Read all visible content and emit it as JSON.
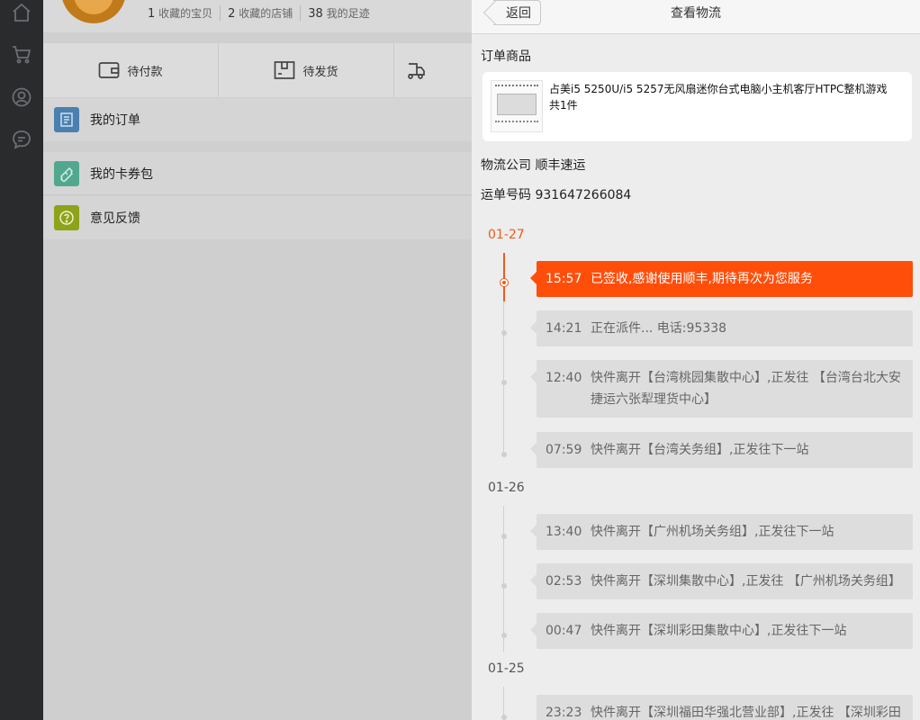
{
  "sidebar": {
    "icons": [
      "home-icon",
      "cart-icon",
      "user-icon",
      "message-icon"
    ]
  },
  "profile": {
    "stats": [
      {
        "num": "1",
        "label": "收藏的宝贝"
      },
      {
        "num": "2",
        "label": "收藏的店铺"
      },
      {
        "num": "38",
        "label": "我的足迹"
      }
    ]
  },
  "order_tabs": [
    {
      "label": "待付款",
      "icon": "wallet-icon"
    },
    {
      "label": "待发货",
      "icon": "package-icon"
    },
    {
      "label": "",
      "icon": "truck-icon"
    }
  ],
  "menu": {
    "my_orders": "我的订单",
    "coupons": "我的卡券包",
    "feedback": "意见反馈"
  },
  "colors": {
    "accent": "#ff4e0a",
    "order_icon": "#4a7fb0",
    "coupon_icon": "#52a88f",
    "feedback_icon": "#8ea21a"
  },
  "panel": {
    "back_label": "返回",
    "title": "查看物流",
    "section_title": "订单商品",
    "product": {
      "name": "占美i5 5250U/i5 5257无风扇迷你台式电脑小主机客厅HTPC整机游戏",
      "qty": "共1件"
    },
    "carrier_line": "物流公司 顺丰速运",
    "tracking_line": "运单号码 931647266084"
  },
  "timeline": [
    {
      "date": "01-27",
      "events": [
        {
          "time": "15:57",
          "text": "已签收,感谢使用顺丰,期待再次为您服务",
          "active": true
        },
        {
          "time": "14:21",
          "text": "正在派件... 电话:95338"
        },
        {
          "time": "12:40",
          "text": "快件离开【台湾桃园集散中心】,正发往 【台湾台北大安捷运六张犁理货中心】"
        },
        {
          "time": "07:59",
          "text": "快件离开【台湾关务组】,正发往下一站"
        }
      ]
    },
    {
      "date": "01-26",
      "events": [
        {
          "time": "13:40",
          "text": "快件离开【广州机场关务组】,正发往下一站"
        },
        {
          "time": "02:53",
          "text": "快件离开【深圳集散中心】,正发往 【广州机场关务组】"
        },
        {
          "time": "00:47",
          "text": "快件离开【深圳彩田集散中心】,正发往下一站"
        }
      ]
    },
    {
      "date": "01-25",
      "events": [
        {
          "time": "23:23",
          "text": "快件离开【深圳福田华强北营业部】,正发往 【深圳彩田"
        }
      ]
    }
  ]
}
